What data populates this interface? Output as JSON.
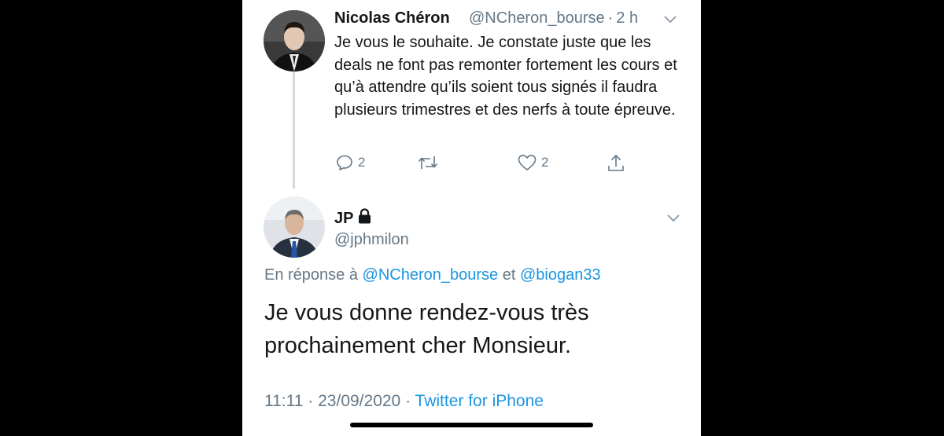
{
  "reply_tweet": {
    "author_name": "Nicolas Chéron",
    "author_handle": "@NCheron_bourse",
    "separator": "·",
    "time": "2 h",
    "text": "Je vous le souhaite. Je constate juste que les deals ne font pas remonter fortement les cours et qu’à attendre qu’ils soient tous signés il faudra plusieurs trimestres et des nerfs à toute épreuve.",
    "reply_count": "2",
    "like_count": "2"
  },
  "main_tweet": {
    "author_name": "JP",
    "author_handle": "@jphmilon",
    "reply_prefix": "En réponse à",
    "reply_to_1": "@NCheron_bourse",
    "reply_and": "et",
    "reply_to_2": "@biogan33",
    "text": "Je vous donne rendez-vous très prochainement cher Monsieur.",
    "time": "11:11",
    "separator": "·",
    "date": "23/09/2020",
    "separator2": "·",
    "source": "Twitter for iPhone"
  },
  "icons": {
    "reply": "comment-icon",
    "retweet": "retweet-icon",
    "like": "heart-icon",
    "share": "share-icon",
    "lock": "lock-icon",
    "chevron": "chevron-down-icon"
  },
  "colors": {
    "link": "#1b95e0",
    "secondary_text": "#657786",
    "primary_text": "#14171a"
  }
}
